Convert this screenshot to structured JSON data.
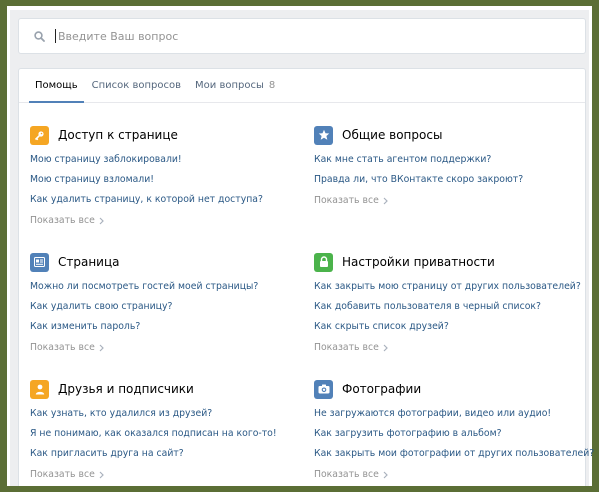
{
  "search": {
    "placeholder": "Введите Ваш вопрос",
    "value": ""
  },
  "tabs": [
    {
      "label": "Помощь",
      "active": true
    },
    {
      "label": "Список вопросов",
      "active": false
    },
    {
      "label": "Мои вопросы",
      "count": "8",
      "active": false
    }
  ],
  "sections": [
    {
      "title": "Доступ к странице",
      "icon": "key-icon",
      "color": "#f5a623",
      "links": [
        "Мою страницу заблокировали!",
        "Мою страницу взломали!",
        "Как удалить страницу, к которой нет доступа?"
      ],
      "show_all": "Показать все"
    },
    {
      "title": "Общие вопросы",
      "icon": "star-icon",
      "color": "#5181b8",
      "links": [
        "Как мне стать агентом поддержки?",
        "Правда ли, что ВКонтакте скоро закроют?"
      ],
      "show_all": "Показать все"
    },
    {
      "title": "Страница",
      "icon": "profile-card-icon",
      "color": "#5181b8",
      "links": [
        "Можно ли посмотреть гостей моей страницы?",
        "Как удалить свою страницу?",
        "Как изменить пароль?"
      ],
      "show_all": "Показать все"
    },
    {
      "title": "Настройки приватности",
      "icon": "lock-icon",
      "color": "#4bb34b",
      "links": [
        "Как закрыть мою страницу от других пользователей?",
        "Как добавить пользователя в черный список?",
        "Как скрыть список друзей?"
      ],
      "show_all": "Показать все"
    },
    {
      "title": "Друзья и подписчики",
      "icon": "person-icon",
      "color": "#f5a623",
      "links": [
        "Как узнать, кто удалился из друзей?",
        "Я не понимаю, как оказался подписан на кого-то!",
        "Как пригласить друга на сайт?"
      ],
      "show_all": "Показать все"
    },
    {
      "title": "Фотографии",
      "icon": "camera-icon",
      "color": "#5181b8",
      "links": [
        "Не загружаются фотографии, видео или аудио!",
        "Как загрузить фотографию в альбом?",
        "Как закрыть мои фотографии от других пользователей?"
      ],
      "show_all": "Показать все"
    }
  ]
}
